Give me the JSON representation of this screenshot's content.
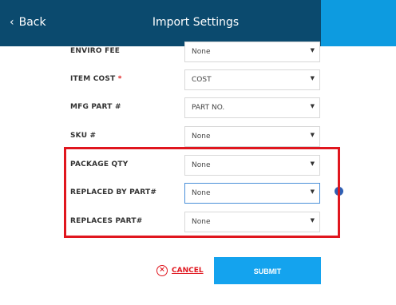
{
  "header": {
    "back_label": "Back",
    "title": "Import Settings"
  },
  "fields": [
    {
      "label": "ENVIRO FEE",
      "required": false,
      "value": "None"
    },
    {
      "label": "ITEM COST",
      "required": true,
      "value": "COST"
    },
    {
      "label": "MFG PART #",
      "required": false,
      "value": "PART NO."
    },
    {
      "label": "SKU #",
      "required": false,
      "value": "None"
    },
    {
      "label": "PACKAGE QTY",
      "required": false,
      "value": "None"
    },
    {
      "label": "REPLACED BY PART#",
      "required": false,
      "value": "None"
    },
    {
      "label": "REPLACES PART#",
      "required": false,
      "value": "None"
    }
  ],
  "required_marker": "*",
  "actions": {
    "cancel_label": "CANCEL",
    "submit_label": "SUBMIT"
  },
  "colors": {
    "header_bg": "#0b4a6e",
    "header_accent": "#0d9be0",
    "highlight_box": "#e0161e",
    "submit_bg": "#14a3ee"
  }
}
